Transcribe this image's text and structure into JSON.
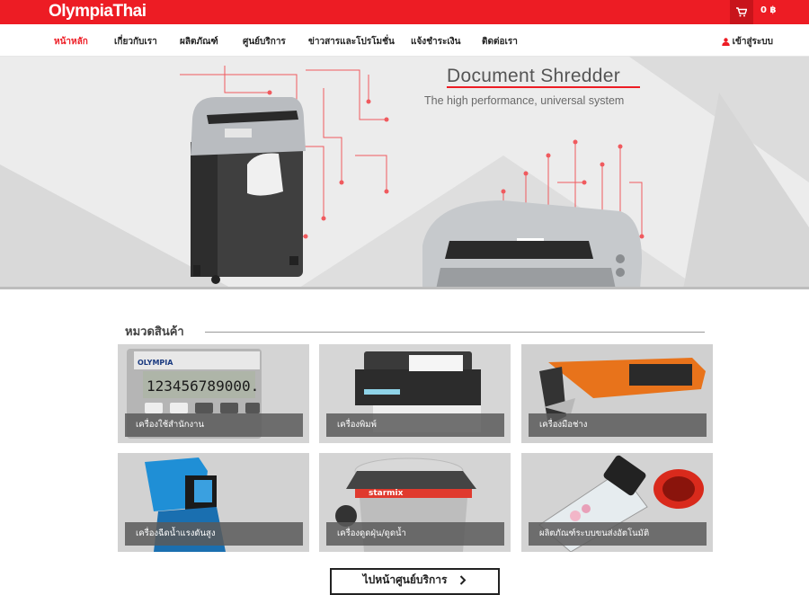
{
  "brand": {
    "logo_text": "OlympiaThai",
    "accent_color": "#ed1c24"
  },
  "header": {
    "cart_count": "0 ฿",
    "cart_icon": "shopping-cart-icon"
  },
  "nav": {
    "items": [
      "หน้าหลัก",
      "เกี่ยวกับเรา",
      "ผลิตภัณฑ์",
      "ศูนย์บริการ",
      "ข่าวสารและโปรโมชั่น",
      "แจ้งชำระเงิน",
      "ติดต่อเรา"
    ],
    "active_index": 0,
    "login_label": "เข้าสู่ระบบ",
    "login_icon": "user-icon"
  },
  "hero": {
    "title": "Document Shredder",
    "subtitle": "The high performance, universal system"
  },
  "categories": {
    "title": "หมวดสินค้า",
    "items": [
      "เครื่องใช้สำนักงาน",
      "เครื่องพิมพ์",
      "เครื่องมือช่าง",
      "เครื่องฉีดน้ำแรงดันสูง",
      "เครื่องดูดฝุ่น/ดูดน้ำ",
      "ผลิตภัณฑ์ระบบขนส่งอัตโนมัติ"
    ],
    "image_text": {
      "calculator_brand": "OLYMPIA",
      "calculator_display": "123456789000.",
      "vacuum_brand": "starmix"
    }
  },
  "cta": {
    "label": "ไปหน้าศูนย์บริการ",
    "icon": "chevron-right-icon"
  }
}
